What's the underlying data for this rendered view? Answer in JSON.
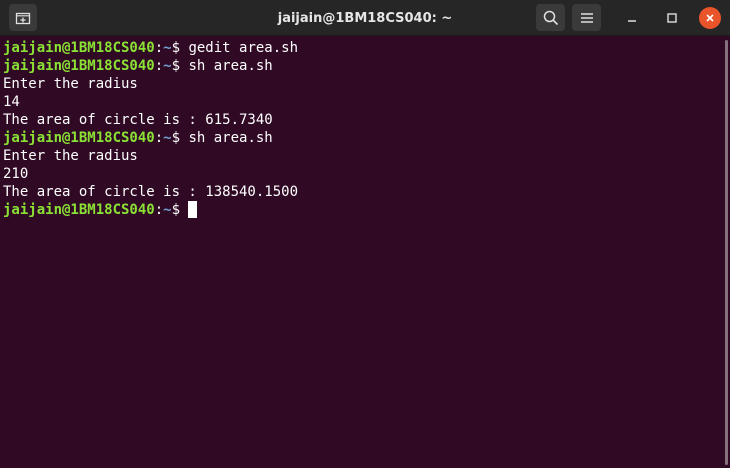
{
  "window": {
    "title": "jaijain@1BM18CS040: ~"
  },
  "titlebar": {
    "icons": {
      "new_tab": "new-tab-icon",
      "search": "search-icon",
      "menu": "hamburger-menu-icon",
      "minimize": "minimize-icon",
      "maximize": "maximize-icon",
      "close": "close-icon"
    }
  },
  "prompt": {
    "user_host": "jaijain@1BM18CS040",
    "separator": ":",
    "path": "~",
    "symbol": "$ "
  },
  "terminal": {
    "lines": [
      {
        "type": "prompt",
        "command": "gedit area.sh"
      },
      {
        "type": "prompt",
        "command": "sh area.sh"
      },
      {
        "type": "output",
        "text": "Enter the radius"
      },
      {
        "type": "output",
        "text": "14"
      },
      {
        "type": "output",
        "text": "The area of circle is : 615.7340"
      },
      {
        "type": "prompt",
        "command": "sh area.sh"
      },
      {
        "type": "output",
        "text": "Enter the radius"
      },
      {
        "type": "output",
        "text": "210"
      },
      {
        "type": "output",
        "text": "The area of circle is : 138540.1500"
      },
      {
        "type": "prompt",
        "command": ""
      }
    ]
  },
  "colors": {
    "background": "#300a24",
    "user_host": "#8ae234",
    "path": "#729fcf",
    "text": "#ffffff",
    "close_button": "#e9542a"
  }
}
